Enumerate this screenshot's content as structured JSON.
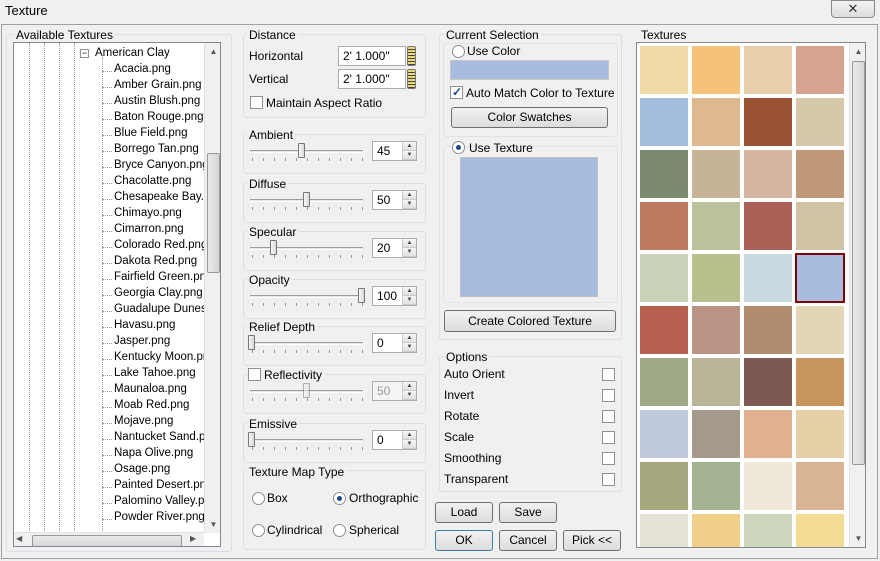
{
  "window": {
    "title": "Texture",
    "close_glyph": "✕"
  },
  "tree": {
    "group_label": "Available Textures",
    "parent": "American Clay",
    "expander": "−",
    "items": [
      "Acacia.png",
      "Amber Grain.png",
      "Austin Blush.png",
      "Baton Rouge.png",
      "Blue Field.png",
      "Borrego Tan.png",
      "Bryce Canyon.png",
      "Chacolatte.png",
      "Chesapeake Bay.p",
      "Chimayo.png",
      "Cimarron.png",
      "Colorado Red.png",
      "Dakota Red.png",
      "Fairfield Green.png",
      "Georgia Clay.png",
      "Guadalupe Dunes.",
      "Havasu.png",
      "Jasper.png",
      "Kentucky Moon.pr",
      "Lake Tahoe.png",
      "Maunaloa.png",
      "Moab Red.png",
      "Mojave.png",
      "Nantucket Sand.p",
      "Napa Olive.png",
      "Osage.png",
      "Painted Desert.png",
      "Palomino Valley.pn",
      "Powder River.png"
    ]
  },
  "distance": {
    "label": "Distance",
    "horizontal_label": "Horizontal",
    "horizontal": "2' 1.000\"",
    "vertical_label": "Vertical",
    "vertical": "2' 1.000\"",
    "aspect_label": "Maintain Aspect Ratio"
  },
  "sliders": [
    {
      "label": "Ambient",
      "value": "45",
      "frac": 0.45,
      "checkbox": false,
      "disabled": false
    },
    {
      "label": "Diffuse",
      "value": "50",
      "frac": 0.5,
      "checkbox": false,
      "disabled": false
    },
    {
      "label": "Specular",
      "value": "20",
      "frac": 0.2,
      "checkbox": false,
      "disabled": false
    },
    {
      "label": "Opacity",
      "value": "100",
      "frac": 1.0,
      "checkbox": false,
      "disabled": false
    },
    {
      "label": "Relief Depth",
      "value": "0",
      "frac": 0.0,
      "checkbox": false,
      "disabled": false
    },
    {
      "label": "Reflectivity",
      "value": "50",
      "frac": 0.5,
      "checkbox": true,
      "disabled": true
    },
    {
      "label": "Emissive",
      "value": "0",
      "frac": 0.0,
      "checkbox": false,
      "disabled": false
    }
  ],
  "maptype": {
    "label": "Texture Map Type",
    "box": "Box",
    "orthographic": "Orthographic",
    "cylindrical": "Cylindrical",
    "spherical": "Spherical",
    "selected": "orthographic"
  },
  "current": {
    "label": "Current Selection",
    "use_color": "Use Color",
    "color": "#a8bce0",
    "auto_match": "Auto Match Color to Texture",
    "swatches_btn": "Color Swatches",
    "use_texture": "Use Texture",
    "create_btn": "Create Colored Texture"
  },
  "options": {
    "label": "Options",
    "items": [
      "Auto Orient",
      "Invert",
      "Rotate",
      "Scale",
      "Smoothing",
      "Transparent"
    ]
  },
  "buttons": {
    "load": "Load",
    "save": "Save",
    "ok": "OK",
    "cancel": "Cancel",
    "pick": "Pick <<"
  },
  "textures": {
    "label": "Textures",
    "selected_index": 19,
    "colors": [
      "#f2d9a8",
      "#f6c27a",
      "#e6cfaa",
      "#d7a48f",
      "#a2bedc",
      "#deb88e",
      "#9c5335",
      "#d7c8a9",
      "#7c8a6f",
      "#c7b396",
      "#d5b4a0",
      "#be9878",
      "#bd7a60",
      "#b9c29c",
      "#ac6057",
      "#d1c2a4",
      "#c8d3b8",
      "#b8c08e",
      "#c9d9df",
      "#a8bce0",
      "#b8604f",
      "#b99484",
      "#b08c70",
      "#e4d5b7",
      "#a1aa88",
      "#b9b597",
      "#7e5855",
      "#c7935f",
      "#bfcbdc",
      "#a59a8c",
      "#e0b08f",
      "#e4cfa7",
      "#a7a77e",
      "#a3b391",
      "#f1e9d8",
      "#d8b495",
      "#e5e1d4",
      "#f0cf88",
      "#ccd6bd",
      "#f3dc93"
    ]
  }
}
